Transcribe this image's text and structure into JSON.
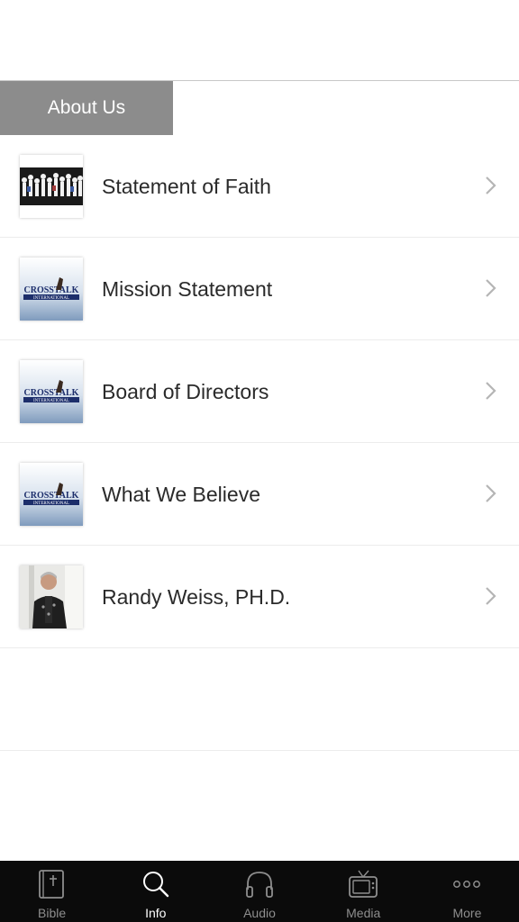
{
  "section_header": "About Us",
  "items": [
    {
      "label": "Statement of Faith",
      "thumb": "group-photo"
    },
    {
      "label": "Mission Statement",
      "thumb": "crosstalk-logo"
    },
    {
      "label": "Board of Directors",
      "thumb": "crosstalk-logo"
    },
    {
      "label": "What We Believe",
      "thumb": "crosstalk-logo"
    },
    {
      "label": "Randy Weiss, PH.D.",
      "thumb": "portrait-photo"
    }
  ],
  "logo_text": {
    "top": "CROSSTALK",
    "bottom": "INTERNATIONAL"
  },
  "tabs": [
    {
      "label": "Bible",
      "icon": "bible-icon",
      "active": false
    },
    {
      "label": "Info",
      "icon": "search-icon",
      "active": true
    },
    {
      "label": "Audio",
      "icon": "headphones-icon",
      "active": false
    },
    {
      "label": "Media",
      "icon": "tv-icon",
      "active": false
    },
    {
      "label": "More",
      "icon": "more-icon",
      "active": false
    }
  ],
  "colors": {
    "header_bg": "#8c8c8c",
    "tab_bar_bg": "#0b0b0b",
    "tab_active": "#ffffff",
    "tab_inactive": "#8e8e8e"
  }
}
